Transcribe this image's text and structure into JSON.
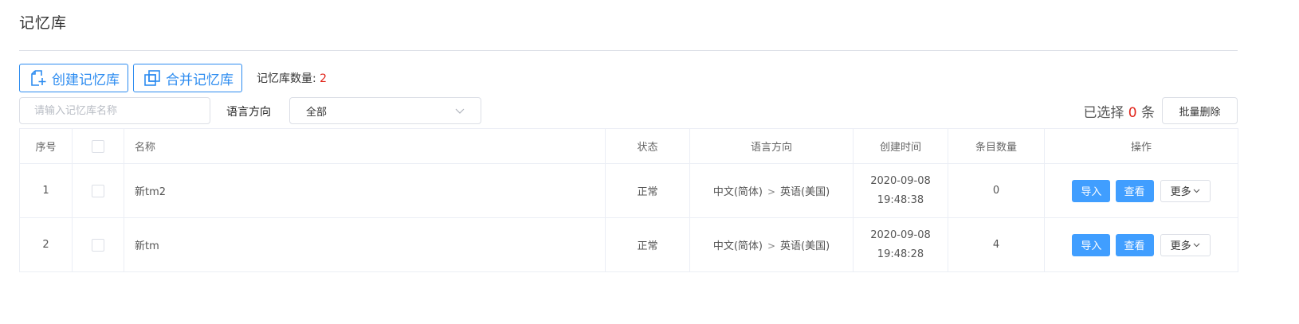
{
  "page": {
    "title": "记忆库"
  },
  "toolbar": {
    "create_label": "创建记忆库",
    "merge_label": "合并记忆库",
    "count_label": "记忆库数量:",
    "count_value": "2"
  },
  "filters": {
    "search_placeholder": "请输入记忆库名称",
    "lang_label": "语言方向",
    "lang_value": "全部",
    "selected_prefix": "已选择",
    "selected_count": "0",
    "selected_suffix": "条",
    "batch_delete_label": "批量删除"
  },
  "table": {
    "headers": {
      "index": "序号",
      "name": "名称",
      "status": "状态",
      "lang": "语言方向",
      "created": "创建时间",
      "count": "条目数量",
      "actions": "操作"
    },
    "rows": [
      {
        "index": "1",
        "name": "新tm2",
        "status": "正常",
        "src_lang": "中文(简体)",
        "tgt_lang": "英语(美国)",
        "date": "2020-09-08",
        "time": "19:48:38",
        "count": "0"
      },
      {
        "index": "2",
        "name": "新tm",
        "status": "正常",
        "src_lang": "中文(简体)",
        "tgt_lang": "英语(美国)",
        "date": "2020-09-08",
        "time": "19:48:28",
        "count": "4"
      }
    ],
    "actions": {
      "import_label": "导入",
      "view_label": "查看",
      "more_label": "更多"
    }
  },
  "colors": {
    "accent": "#2d8cf0",
    "button_blue": "#409eff",
    "highlight_red": "#e1251b",
    "border": "#ebeef5"
  },
  "icons": {
    "create": "new-document-icon",
    "merge": "merge-documents-icon",
    "dropdown": "chevron-down-icon"
  }
}
